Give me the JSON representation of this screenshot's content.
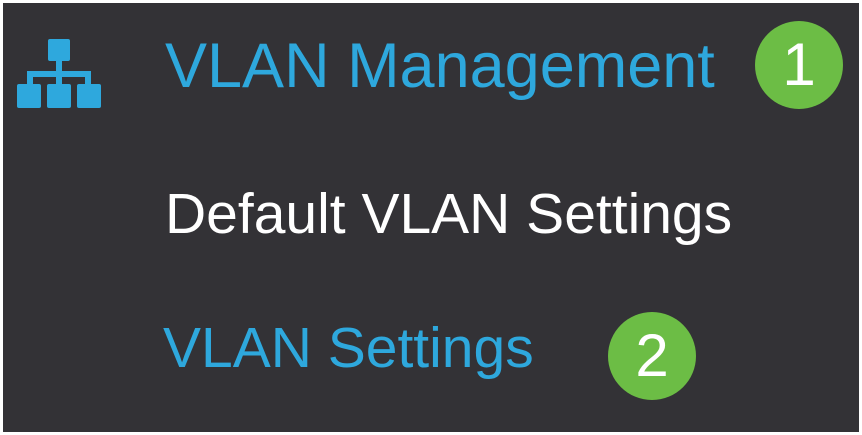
{
  "nav": {
    "section": {
      "label": "VLAN Management",
      "icon": "network-tree-icon",
      "badge": "1",
      "color": "#2ea8dd"
    },
    "items": [
      {
        "label": "Default VLAN Settings",
        "color": "#ffffff"
      },
      {
        "label": "VLAN Settings",
        "badge": "2",
        "color": "#2ea8dd"
      }
    ]
  },
  "colors": {
    "background": "#333236",
    "accent": "#2ea8dd",
    "badge": "#6cbd45"
  }
}
